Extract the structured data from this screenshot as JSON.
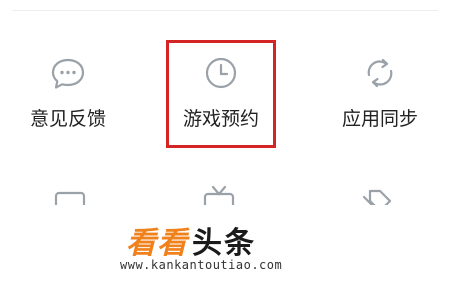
{
  "menu": {
    "items": [
      {
        "label": "意见反馈",
        "icon": "chat-bubble-icon"
      },
      {
        "label": "游戏预约",
        "icon": "clock-icon",
        "highlighted": true
      },
      {
        "label": "应用同步",
        "icon": "sync-icon"
      }
    ],
    "partial_row_icons": [
      "tablet-icon",
      "tv-icon",
      "tag-icon"
    ]
  },
  "watermark": {
    "brand_a": "看看",
    "brand_b": "头条",
    "url": "www.kankantoutiao.com"
  },
  "colors": {
    "icon_gray": "#9aa1a8",
    "highlight_red": "#d42424",
    "brand_orange": "#f0821e"
  }
}
